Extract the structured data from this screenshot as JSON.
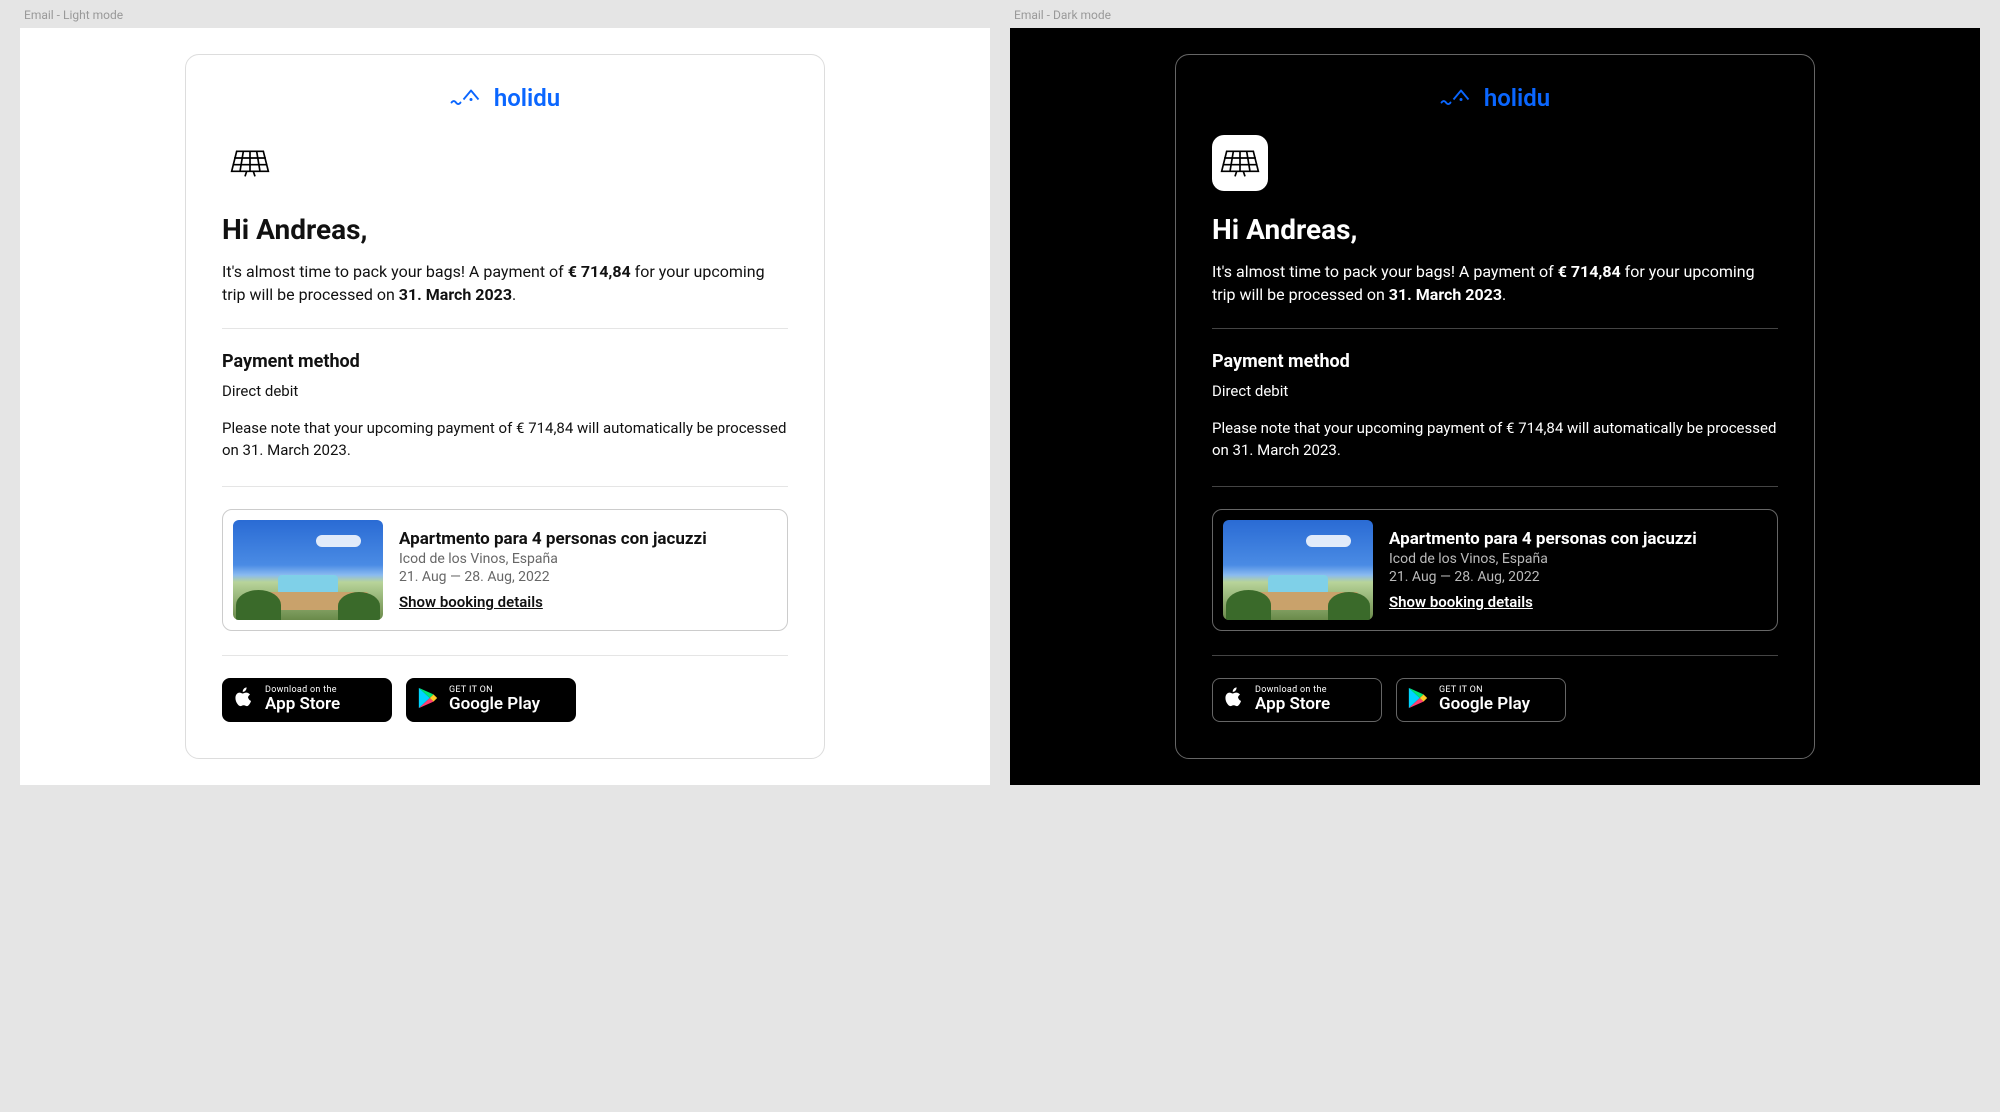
{
  "labels": {
    "light": "Email - Light mode",
    "dark": "Email - Dark mode"
  },
  "brand": "holidu",
  "greeting": "Hi Andreas,",
  "intro": {
    "pre": "It's almost time to pack your bags! A payment of ",
    "amount": "€ 714,84",
    "mid": " for your upcoming trip will be processed on ",
    "date": "31. March 2023",
    "post": "."
  },
  "payment": {
    "heading": "Payment method",
    "method": "Direct debit",
    "note": "Please note that your upcoming payment of € 714,84 will automatically be processed on 31. March 2023."
  },
  "booking": {
    "title": "Apartmento para 4 personas con jacuzzi",
    "location": "Icod de los Vinos, España",
    "dates": "21. Aug — 28. Aug, 2022",
    "link": "Show booking details"
  },
  "stores": {
    "apple": {
      "small": "Download on the",
      "big": "App Store"
    },
    "google": {
      "small": "GET IT ON",
      "big": "Google Play"
    }
  }
}
